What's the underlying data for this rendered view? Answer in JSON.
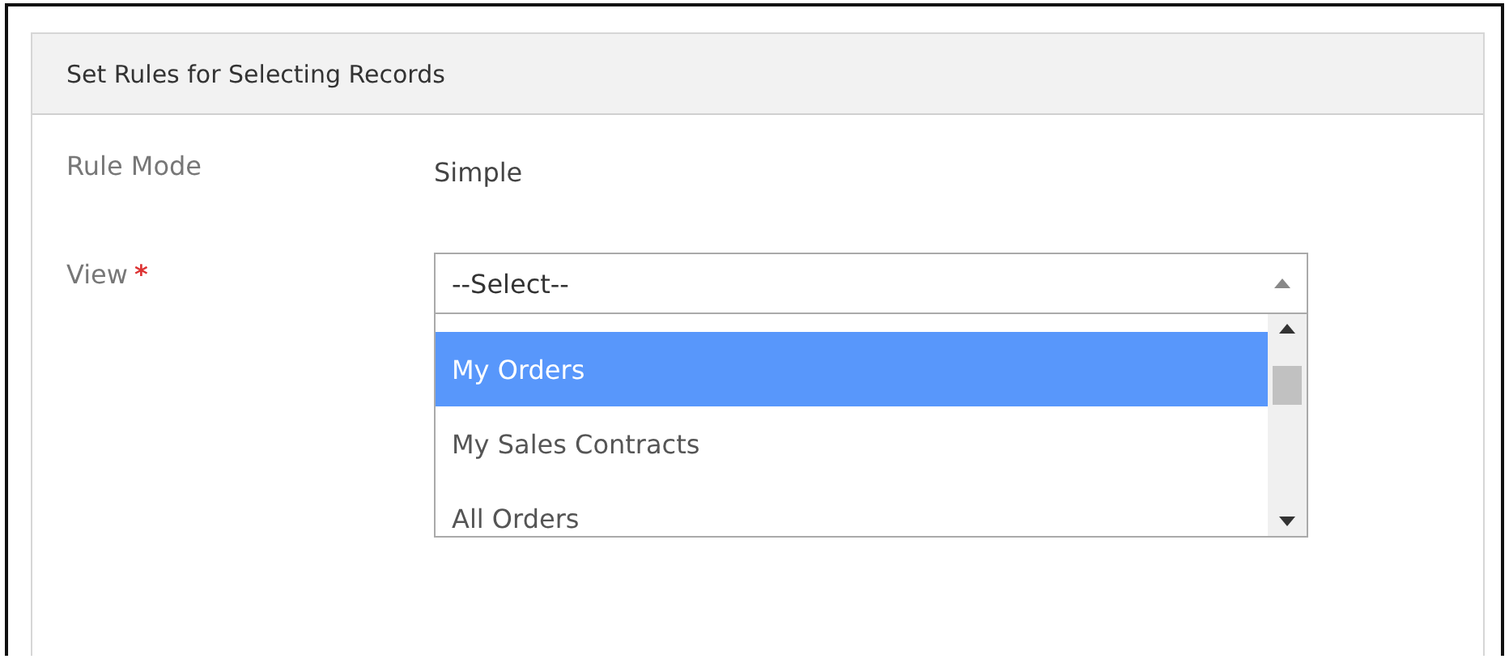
{
  "panel": {
    "title": "Set Rules for Selecting Records"
  },
  "fields": [
    {
      "kind": "text",
      "label": "Rule Mode",
      "value": "Simple"
    },
    {
      "kind": "dropdown",
      "label": "View",
      "required_mark": "*",
      "value": "--Select--",
      "expanded": true,
      "options": [
        {
          "label": "My Orders",
          "selected": true
        },
        {
          "label": "My Sales Contracts",
          "selected": false
        },
        {
          "label": "All Orders",
          "selected": false
        }
      ]
    }
  ]
}
